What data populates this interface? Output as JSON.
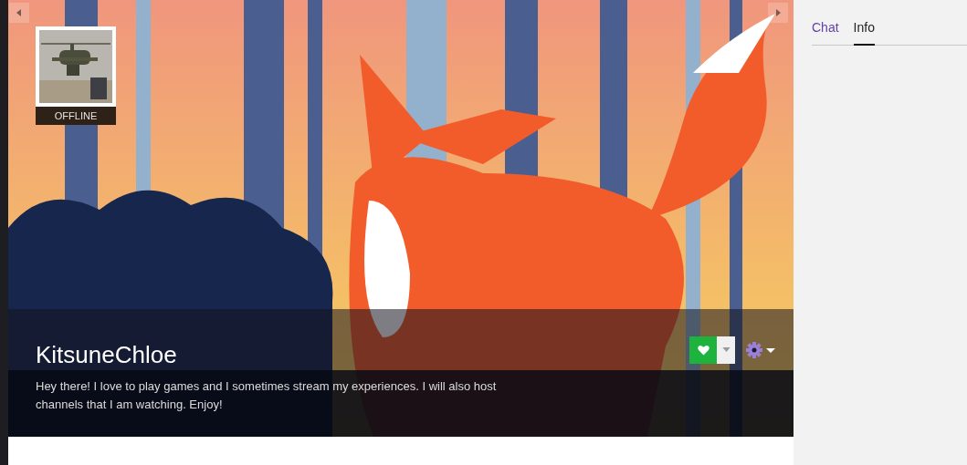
{
  "channel": {
    "status": "OFFLINE",
    "name": "KitsuneChloe",
    "bio": "Hey there! I love to play games and I sometimes stream my experiences. I will also host channels that I am watching. Enjoy!"
  },
  "tabs": [
    {
      "label": "Chat",
      "selected": false
    },
    {
      "label": "Info",
      "selected": true
    }
  ]
}
